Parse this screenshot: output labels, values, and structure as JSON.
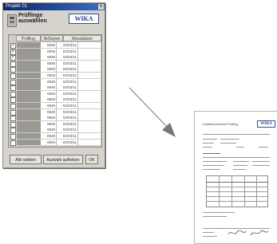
{
  "dialog": {
    "title": "Projekt 01",
    "heading": "Prüflinge auswählen",
    "logo": "WIKA",
    "close_label": "x",
    "columns": [
      "Prüfling",
      "Nr/Serien",
      "Messdatum"
    ],
    "rows": [
      {
        "checked": true,
        "nr": "0836",
        "date": "02/03/11"
      },
      {
        "checked": true,
        "nr": "0836",
        "date": "02/03/11"
      },
      {
        "checked": true,
        "nr": "0838",
        "date": "02/03/11"
      },
      {
        "checked": false,
        "nr": "0839",
        "date": "02/03/11"
      },
      {
        "checked": false,
        "nr": "0846",
        "date": "02/03/11"
      },
      {
        "checked": false,
        "nr": "0848",
        "date": "02/03/11"
      },
      {
        "checked": false,
        "nr": "0848",
        "date": "02/03/11"
      },
      {
        "checked": false,
        "nr": "0848",
        "date": "02/03/11"
      },
      {
        "checked": false,
        "nr": "0848",
        "date": "02/03/11"
      },
      {
        "checked": false,
        "nr": "0848",
        "date": "02/03/11"
      },
      {
        "checked": false,
        "nr": "0849",
        "date": "02/03/11"
      },
      {
        "checked": false,
        "nr": "0849",
        "date": "02/03/11"
      },
      {
        "checked": false,
        "nr": "0849",
        "date": "02/03/11"
      },
      {
        "checked": false,
        "nr": "0849",
        "date": "02/03/11"
      },
      {
        "checked": false,
        "nr": "0849",
        "date": "02/03/11"
      },
      {
        "checked": false,
        "nr": "0849",
        "date": "02/03/11"
      },
      {
        "checked": false,
        "nr": "0849",
        "date": "02/03/11"
      }
    ],
    "buttons": [
      "Alle wählen",
      "Auswahl aufheben",
      "OK"
    ]
  },
  "report": {
    "title": "Kalibrierprotokoll Prüfling",
    "logo": "WIKA"
  },
  "colors": {
    "dialog_bg": "#d6d3cd",
    "titlebar": "#0a246a",
    "wika_blue": "#23418a",
    "arrow": "#777777"
  }
}
